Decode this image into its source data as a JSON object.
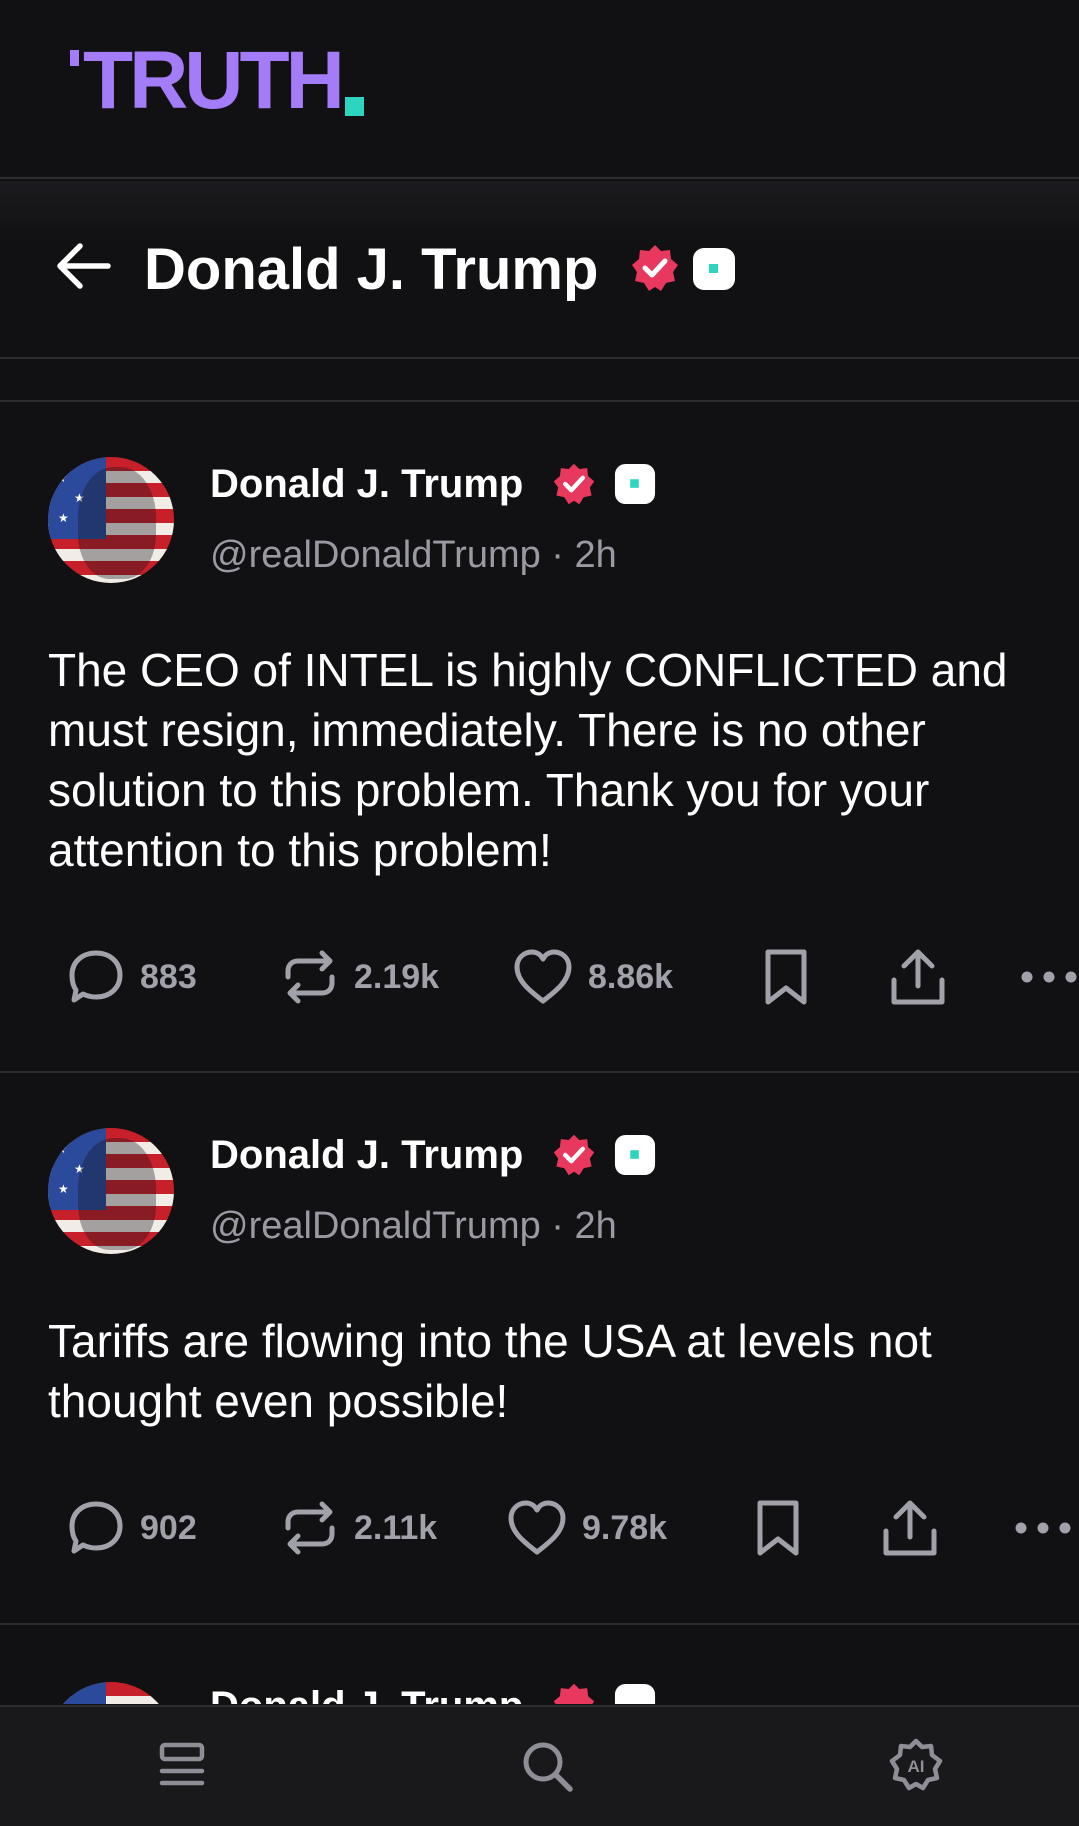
{
  "brand": {
    "logo_text": "TRUTH",
    "accent": "#a47cf7",
    "dot_color": "#2dd4bf"
  },
  "header": {
    "title": "Donald J. Trump",
    "back_icon": "arrow-left-icon"
  },
  "posts": [
    {
      "author": "Donald J. Trump",
      "handle": "@realDonaldTrump · 2h",
      "text": "The CEO of INTEL is highly CONFLICTED and must resign, immediately. There is no other solution to this problem. Thank you for your attention to this problem!",
      "replies": "883",
      "retruths": "2.19k",
      "likes": "8.86k"
    },
    {
      "author": "Donald J. Trump",
      "handle": "@realDonaldTrump · 2h",
      "text": "Tariffs are flowing into the USA at levels not thought even possible!",
      "replies": "902",
      "retruths": "2.11k",
      "likes": "9.78k"
    },
    {
      "author": "Donald J. Trump"
    }
  ],
  "colors": {
    "background": "#111113",
    "verified": "#e8385d",
    "muted_text": "#9a9aa3",
    "divider": "#2c2c31"
  },
  "bottom_nav": {
    "items": [
      "feed-icon",
      "search-icon",
      "ai-icon"
    ]
  }
}
